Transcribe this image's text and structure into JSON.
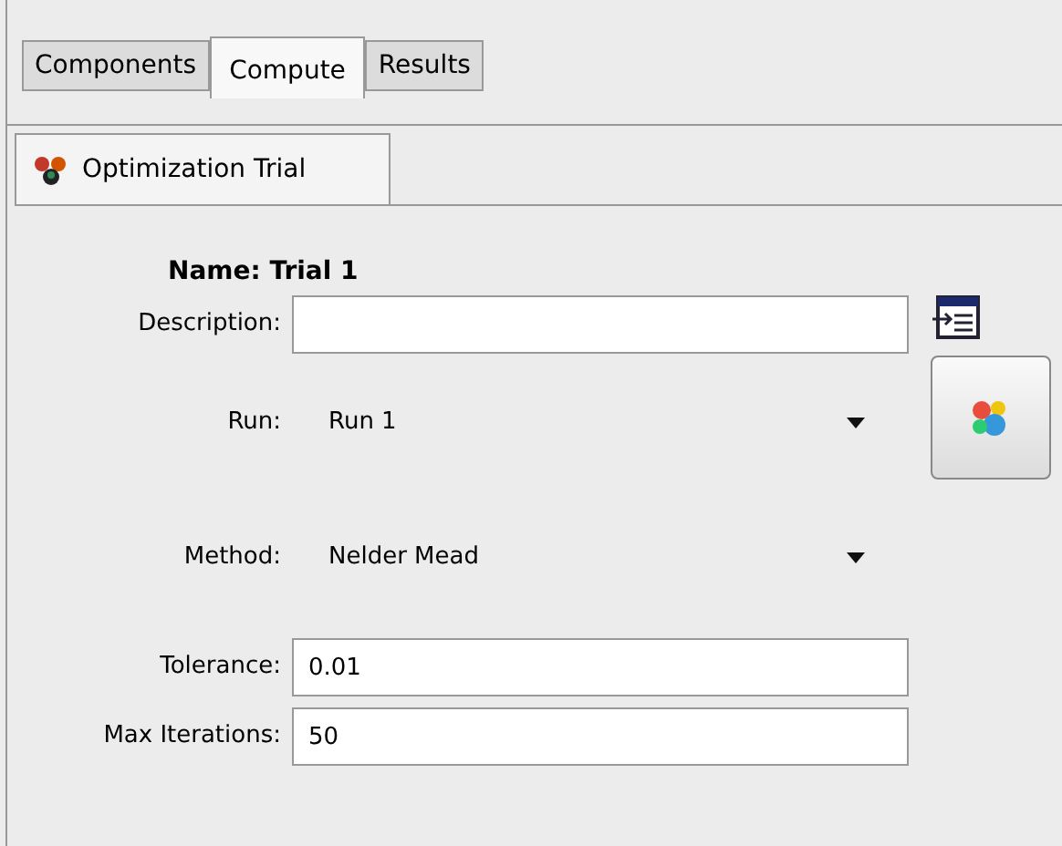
{
  "tabs": [
    {
      "label": "Components",
      "selected": false
    },
    {
      "label": "Compute",
      "selected": true
    },
    {
      "label": "Results",
      "selected": false
    }
  ],
  "sub_tab": {
    "label": "Optimization Trial",
    "selected": true
  },
  "name": "Name: Trial 1",
  "fields": [
    {
      "kind": "text",
      "label": "Description:"
    },
    {
      "kind": "dropdown",
      "label": "Run:",
      "value": "Run 1"
    },
    {
      "kind": "dropdown",
      "label": "Method:",
      "value": "Nelder Mead"
    },
    {
      "kind": "text",
      "label": "Tolerance:",
      "value": "0.01"
    },
    {
      "kind": "text",
      "label": "Max Iterations:",
      "value": "50"
    }
  ]
}
